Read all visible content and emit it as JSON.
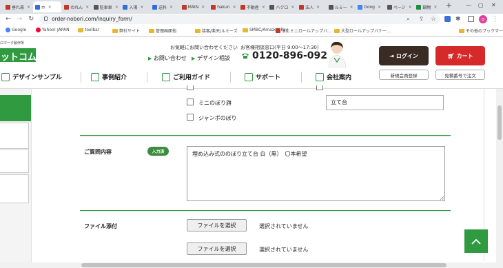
{
  "browser": {
    "tabs": [
      {
        "label": "垂れ幕",
        "color": "#c0392b"
      },
      {
        "label": "ホ",
        "color": "#2f6fd6"
      },
      {
        "label": "のれん",
        "color": "#c0392b"
      },
      {
        "label": "駐車車",
        "color": "#555555"
      },
      {
        "label": "入場",
        "color": "#2f6fd6"
      },
      {
        "label": "送料",
        "color": "#2f6fd6"
      },
      {
        "label": "MAIN",
        "color": "#c0392b"
      },
      {
        "label": "hakun",
        "color": "#c0392b"
      },
      {
        "label": "不動産",
        "color": "#c0392b"
      },
      {
        "label": "ハクロ",
        "color": "#555555"
      },
      {
        "label": "法人",
        "color": "#c0392b"
      },
      {
        "label": "ルミー",
        "color": "#555555"
      },
      {
        "label": "Goog",
        "color": "#4285f4"
      },
      {
        "label": "ページ",
        "color": "#555555"
      },
      {
        "label": "鍋物",
        "color": "#1e8e3e"
      }
    ],
    "new_tab": "+",
    "url": "order-nobori.com/inquiry_form/",
    "avatar_letter": "o",
    "bookmarks": [
      {
        "label": "Google",
        "kind": "google"
      },
      {
        "label": "Yahoo! JAPAN",
        "kind": "yahoo"
      },
      {
        "label": "toolbar",
        "kind": "folder"
      },
      {
        "label": "弊社サイト",
        "kind": "folder"
      },
      {
        "label": "管理画面他",
        "kind": "folder"
      },
      {
        "label": "接客/楽天/ルミーズ",
        "kind": "folder"
      },
      {
        "label": "SMBC/Amazon Pay",
        "kind": "folder"
      },
      {
        "label": "卓上ミニロールアップバ…",
        "kind": "red"
      },
      {
        "label": "大型ロールアップバナー…",
        "kind": "folder"
      }
    ],
    "other_bookmarks": "その他のブックマーク"
  },
  "site": {
    "brand_tagline": "ロマーク製作所",
    "brand_name": "ットコム",
    "contact_caption": "お気軽にお問い合わせください",
    "link_inquiry": "お問い合わせ",
    "link_design": "デザイン相談",
    "phone_caption": "お客様相談窓口(平日 9:00〜17:30)",
    "phone_number": "0120-896-092",
    "login_label": "ログイン",
    "cart_label": "カート",
    "register_label": "新規会員登録",
    "estimate_label": "見積番号で注文",
    "nav": [
      {
        "label": "デザインサンプル"
      },
      {
        "label": "事例紹介"
      },
      {
        "label": "ご利用ガイド"
      },
      {
        "label": "サポート"
      },
      {
        "label": "会社案内"
      }
    ]
  },
  "form": {
    "option_mini": "ミニのぼり旗",
    "option_jumbo": "ジャンボのぼり",
    "stand_value": "立て台",
    "question_label": "ご質問内容",
    "entered_badge": "入力済",
    "question_value": "埋め込み式ののぼり立て台 白（黒）　〇本希望",
    "attach_label": "ファイル添付",
    "file_button_1": "ファイルを選択",
    "file_status_1": "選択されていません",
    "file_button_2": "ファイルを選択",
    "file_status_2": "選択されていません"
  },
  "colors": {
    "accent": "#2f9a3f",
    "login": "#3a2c24",
    "cart": "#d62a2a"
  }
}
